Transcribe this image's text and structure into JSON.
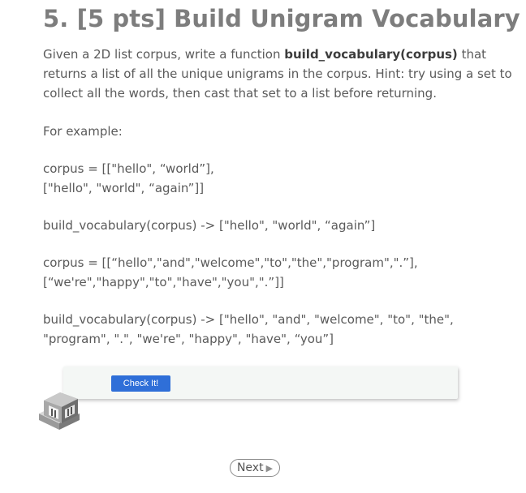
{
  "title": "5. [5 pts] Build Unigram Vocabulary",
  "intro": {
    "line1_pre": "Given a 2D list corpus, write a function ",
    "line1_bold": "build_vocabulary(corpus)",
    "line1_post": " that",
    "line2": "returns a list of all the unique unigrams in the corpus. Hint: try using a set to",
    "line3": "collect all the words, then cast that set to a list before returning."
  },
  "example_label": "For example:",
  "example1": {
    "corpus_line1": "corpus = [[\"hello\", “world”],",
    "corpus_line2": "[\"hello\", \"world\", “again”]]",
    "result": "build_vocabulary(corpus) -> [\"hello\", \"world\", “again”]"
  },
  "example2": {
    "corpus_line1": "corpus = [[“hello\",\"and\",\"welcome\",\"to\",\"the\",\"program\",\".”],",
    "corpus_line2": "[“we're\",\"happy\",\"to\",\"have\",\"you\",\".”]]",
    "result_line1": "build_vocabulary(corpus) -> [\"hello\", \"and\", \"welcome\", \"to\", \"the\",",
    "result_line2": "\"program\", \".\", \"we're\", \"happy\", \"have\", “you”]"
  },
  "check_button": "Check It!",
  "next_button": "Next",
  "icons": {
    "robot": "robot-mascot-icon",
    "next": "play-triangle-icon"
  },
  "colors": {
    "accent": "#2f6fd8",
    "title": "#7d7d7d",
    "text": "#5a5a5a"
  }
}
